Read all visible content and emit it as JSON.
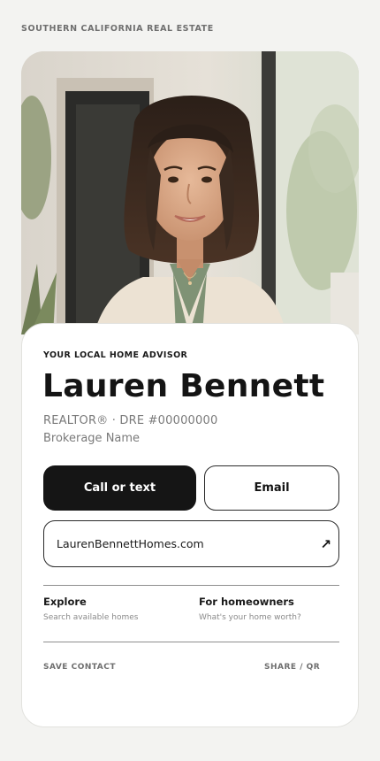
{
  "header": {
    "eyebrow": "SOUTHERN CALIFORNIA REAL ESTATE"
  },
  "profile": {
    "kicker": "YOUR LOCAL HOME ADVISOR",
    "name": "Lauren Bennett",
    "license": "REALTOR® · DRE #00000000",
    "brokerage": "Brokerage Name"
  },
  "actions": {
    "call_label": "Call or text",
    "email_label": "Email",
    "website_label": "LaurenBennettHomes.com",
    "website_icon": "external-link-arrow-icon"
  },
  "links": [
    {
      "title": "Explore",
      "subtitle": "Search available homes"
    },
    {
      "title": "For homeowners",
      "subtitle": "What's your home worth?"
    }
  ],
  "footer": {
    "save_label": "SAVE CONTACT",
    "share_label": "SHARE / QR"
  },
  "colors": {
    "page_bg": "#f3f3f1",
    "card_bg": "#ffffff",
    "primary_button": "#151515",
    "muted_text": "#7a7a7a"
  }
}
